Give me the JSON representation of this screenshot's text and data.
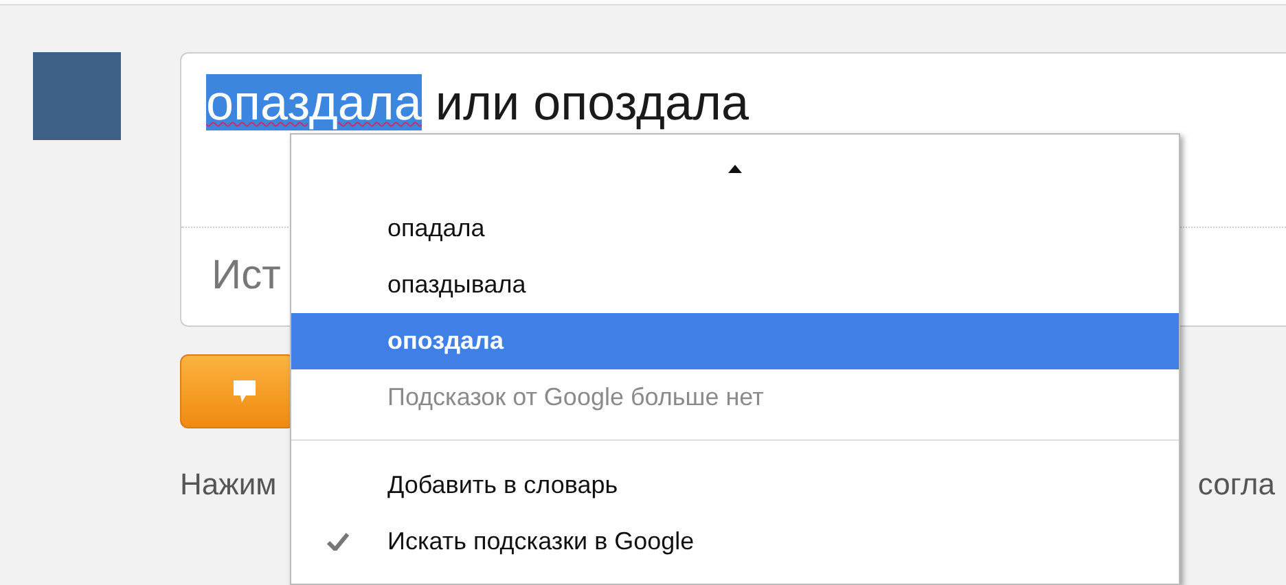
{
  "comment_field": {
    "value_parts": [
      {
        "text": "опаздала",
        "selected": true,
        "misspelled": true
      },
      {
        "text": " или опоздала",
        "selected": false,
        "misspelled": false
      }
    ],
    "second_field_text": "Ист"
  },
  "footer_text": {
    "left": "Нажим",
    "right": "согла"
  },
  "context_menu": {
    "items": [
      {
        "kind": "suggestion",
        "label": "опадала",
        "selected": false
      },
      {
        "kind": "suggestion",
        "label": "опаздывала",
        "selected": false
      },
      {
        "kind": "suggestion",
        "label": "опоздала",
        "selected": true
      },
      {
        "kind": "hint",
        "label": "Подсказок от Google больше нет",
        "selected": false
      },
      {
        "kind": "separator"
      },
      {
        "kind": "action",
        "label": "Добавить в словарь",
        "selected": false,
        "checked": false
      },
      {
        "kind": "action",
        "label": "Искать подсказки в Google",
        "selected": false,
        "checked": true
      }
    ]
  }
}
